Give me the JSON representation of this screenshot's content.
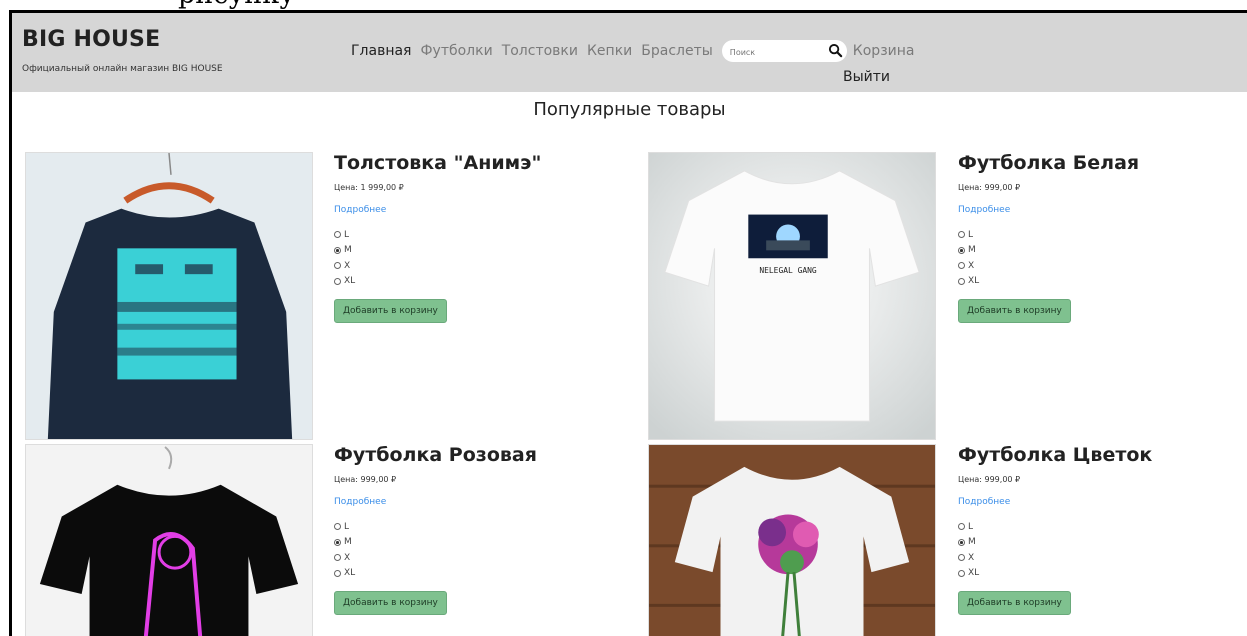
{
  "top_caption": "рисунку",
  "header": {
    "brand": "BIG HOUSE",
    "tagline": "Официальный онлайн магазин BIG HOUSE",
    "nav": [
      "Главная",
      "Футболки",
      "Толстовки",
      "Кепки",
      "Браслеты"
    ],
    "search_placeholder": "Поиск",
    "cart": "Корзина",
    "logout": "Выйти"
  },
  "section_title": "Популярные товары",
  "products": [
    {
      "name": "Толстовка \"Анимэ\"",
      "price": "Цена: 1 999,00 ₽",
      "more": "Подробнее",
      "sizes": [
        "L",
        "M",
        "X",
        "XL"
      ],
      "selected": "M",
      "button": "Добавить в корзину",
      "image_icon": "sweatshirt-anime-image"
    },
    {
      "name": "Футболка Белая",
      "price": "Цена: 999,00 ₽",
      "more": "Подробнее",
      "sizes": [
        "L",
        "M",
        "X",
        "XL"
      ],
      "selected": "M",
      "button": "Добавить в корзину",
      "image_icon": "white-tshirt-image",
      "print_text": "NELEGAL GANG"
    },
    {
      "name": "Футболка Розовая",
      "price": "Цена: 999,00 ₽",
      "more": "Подробнее",
      "sizes": [
        "L",
        "M",
        "X",
        "XL"
      ],
      "selected": "M",
      "button": "Добавить в корзину",
      "image_icon": "black-tshirt-pink-print-image"
    },
    {
      "name": "Футболка Цветок",
      "price": "Цена: 999,00 ₽",
      "more": "Подробнее",
      "sizes": [
        "L",
        "M",
        "X",
        "XL"
      ],
      "selected": "M",
      "button": "Добавить в корзину",
      "image_icon": "flower-tshirt-image"
    }
  ],
  "colors": {
    "header_bg": "#d6d6d6",
    "link": "#3b8ee8",
    "button_bg": "#7fc18f"
  }
}
